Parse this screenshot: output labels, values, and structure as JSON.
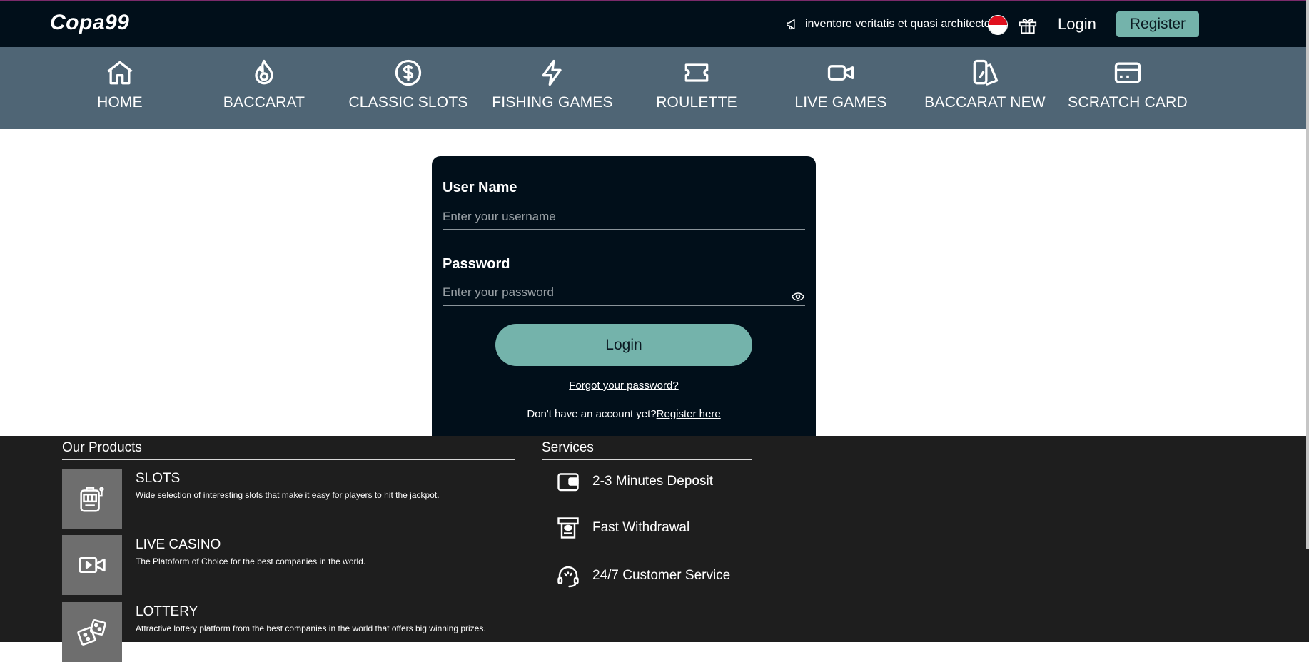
{
  "header": {
    "logo": "Copa99",
    "announcement": "inventore veritatis et quasi architecto",
    "login_label": "Login",
    "register_label": "Register"
  },
  "nav": {
    "items": [
      {
        "label": "HOME",
        "icon": "home-icon"
      },
      {
        "label": "BACCARAT",
        "icon": "flame-icon"
      },
      {
        "label": "CLASSIC SLOTS",
        "icon": "dollar-coin-icon"
      },
      {
        "label": "FISHING GAMES",
        "icon": "lightning-icon"
      },
      {
        "label": "ROULETTE",
        "icon": "ticket-icon"
      },
      {
        "label": "LIVE GAMES",
        "icon": "video-camera-icon"
      },
      {
        "label": "BACCARAT NEW",
        "icon": "cards-icon"
      },
      {
        "label": "SCRATCH CARD",
        "icon": "credit-card-icon"
      }
    ]
  },
  "login_form": {
    "username_label": "User Name",
    "username_placeholder": "Enter your username",
    "username_value": "",
    "password_label": "Password",
    "password_placeholder": "Enter your password",
    "password_value": "",
    "submit_label": "Login",
    "forgot_label": "Forgot your password?",
    "no_account_text": "Don't have an account yet?",
    "register_link": "Register here"
  },
  "footer": {
    "products_title": "Our Products",
    "products": [
      {
        "title": "SLOTS",
        "desc": "Wide selection of interesting slots that make it easy for players to hit the jackpot.",
        "icon": "slot-machine-icon"
      },
      {
        "title": "LIVE CASINO",
        "desc": "The Platoform of Choice for the best companies in the world.",
        "icon": "video-camera-icon"
      },
      {
        "title": "LOTTERY",
        "desc": "Attractive lottery platform from the best companies in the world that offers big winning prizes.",
        "icon": "dice-icon"
      }
    ],
    "services_title": "Services",
    "services": [
      {
        "label": "2-3 Minutes Deposit",
        "icon": "wallet-icon"
      },
      {
        "label": "Fast Withdrawal",
        "icon": "atm-icon"
      },
      {
        "label": "24/7 Customer Service",
        "icon": "headset-icon"
      }
    ]
  },
  "colors": {
    "header_bg": "#010f1a",
    "nav_bg": "#4f6575",
    "accent": "#74b3ab",
    "footer_bg": "#1e1e1e"
  }
}
